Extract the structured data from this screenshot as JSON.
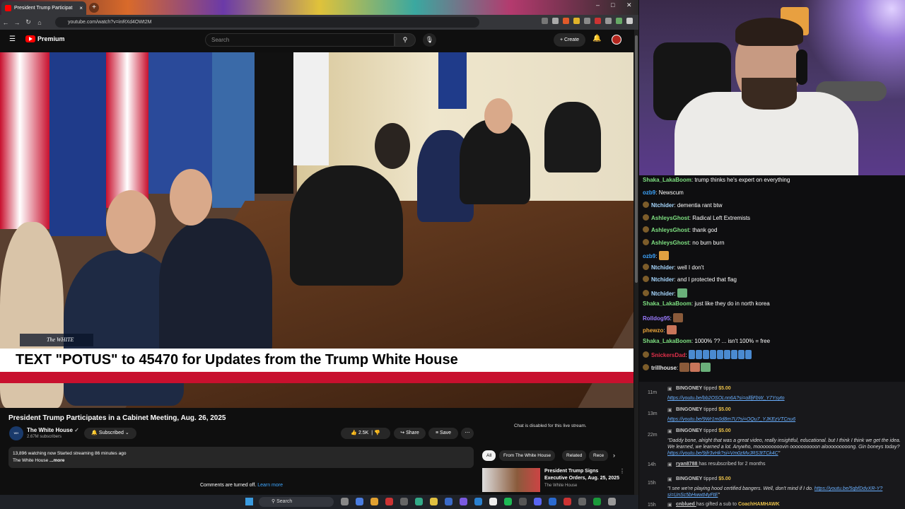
{
  "browser": {
    "tab_title": "President Trump Participat",
    "url": "youtube.com/watch?v=inRXd4OWt2M",
    "search_placeholder": "Search",
    "logo_text": "Premium",
    "create_label": "Create"
  },
  "video": {
    "banner": "TEXT \"POTUS\" to 45470 for Updates from the Trump White House",
    "bug": "The WHITE HOUSE",
    "title": "President Trump Participates in a Cabinet Meeting, Aug. 26, 2025",
    "channel": "The White House",
    "subscribers": "2.67M subscribers",
    "subscribed_label": "Subscribed",
    "likes": "2.5K",
    "share_label": "Share",
    "save_label": "Save",
    "desc_line1": "13,896 watching now  Started streaming 86 minutes ago",
    "desc_line2": "The White House",
    "more_label": "...more",
    "comments_off": "Comments are turned off.",
    "learn_more": "Learn more",
    "chat_disabled": "Chat is disabled for this live stream."
  },
  "recommend": {
    "chips": [
      "All",
      "From The White House",
      "Related",
      "Rece"
    ],
    "title": "President Trump Signs Executive Orders, Aug. 25, 2025",
    "channel": "The White House"
  },
  "taskbar": {
    "search": "Search"
  },
  "chat": [
    {
      "user": "Shaka_LakaBoom",
      "color": "#7ee081",
      "text": "trump thinks he's expert on everything",
      "badge": false
    },
    {
      "user": "ozb9",
      "color": "#3ea6ff",
      "text": "Newscum",
      "badge": false
    },
    {
      "user": "Ntchider",
      "color": "#a8d8ff",
      "text": "dementia rant btw",
      "badge": true
    },
    {
      "user": "AshleysGhost",
      "color": "#7ee081",
      "text": "Radical Left Extremists",
      "badge": true
    },
    {
      "user": "AshleysGhost",
      "color": "#7ee081",
      "text": "thank god",
      "badge": true
    },
    {
      "user": "AshleysGhost",
      "color": "#7ee081",
      "text": "no burn burn",
      "badge": true
    },
    {
      "user": "ozb9",
      "color": "#3ea6ff",
      "text": "",
      "badge": false
    },
    {
      "user": "Ntchider",
      "color": "#a8d8ff",
      "text": "well I don't",
      "badge": true
    },
    {
      "user": "Ntchider",
      "color": "#a8d8ff",
      "text": "and I protected that flag",
      "badge": true
    },
    {
      "user": "Ntchider",
      "color": "#a8d8ff",
      "text": "",
      "badge": true
    },
    {
      "user": "Shaka_LakaBoom",
      "color": "#7ee081",
      "text": "just like they do in north korea",
      "badge": false
    },
    {
      "user": "Rolldog95",
      "color": "#9b7bff",
      "text": "",
      "badge": false
    },
    {
      "user": "phewzo",
      "color": "#e8a33a",
      "text": "",
      "badge": false
    },
    {
      "user": "Shaka_LakaBoom",
      "color": "#7ee081",
      "text": "1000% ?? ... isn't 100% = free",
      "badge": false
    },
    {
      "user": "SnickersDad",
      "color": "#e0304a",
      "text": "",
      "badge": true
    },
    {
      "user": "trillhouse",
      "color": "#e8e8e8",
      "text": "",
      "badge": true
    }
  ],
  "events": [
    {
      "time": "11m",
      "name": "BINGONEY",
      "action": "tipped",
      "amount": "$5.00",
      "body": "https://youtu.be/bb2OSOLnn6A?si=ollfjFbW_Y7Ysyto"
    },
    {
      "time": "13m",
      "name": "BINGONEY",
      "action": "tipped",
      "amount": "$5.00",
      "body": "https://youtu.be/9Wr1m0d8m7U?si=OQu7_YJKEzVTCnu6"
    },
    {
      "time": "22m",
      "name": "BINGONEY",
      "action": "tipped",
      "amount": "$5.00",
      "body": "\"Daddy bone, alright that was a great video, really insightful, educational. but I think I think we get the idea. We learned, we learned a lot. Anywho, mooooooooovin oooooooooon alooooooooong. Gin boneys today? https://youtu.be/9jfr3vHk?si=Vm0zMvJRS3tTCk4C\""
    },
    {
      "time": "14h",
      "name": "ryan8788",
      "action": "has resubscribed for 2 months",
      "amount": "",
      "body": ""
    },
    {
      "time": "15h",
      "name": "BINGONEY",
      "action": "tipped",
      "amount": "$5.00",
      "body": "\"I see we're playing hood certified bangers. Well, don't mind if I do. https://youtu.be/5qbfDdvXR-Y?si=UnSc5bHwwtI4yFtE\""
    },
    {
      "time": "15h",
      "name": "cnblued",
      "action": "has gifted a sub to",
      "amount": "CoachHAMHAWK",
      "body": ""
    }
  ]
}
